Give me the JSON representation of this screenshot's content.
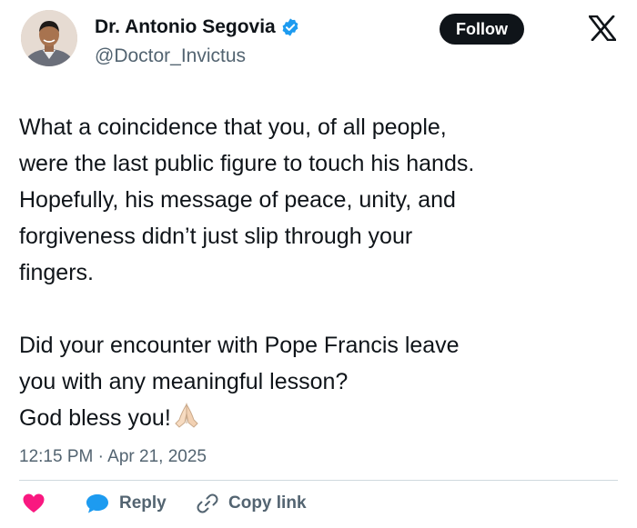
{
  "author": {
    "display_name": "Dr. Antonio Segovia",
    "handle": "@Doctor_Invictus",
    "verified": true,
    "avatar_icon": "profile-photo"
  },
  "header": {
    "follow_label": "Follow",
    "logo_icon": "x-logo-icon"
  },
  "tweet": {
    "text": "What a coincidence that you, of all people,\nwere the last public figure to touch his hands.\nHopefully, his message of peace, unity, and\nforgiveness didn’t just slip through your\nfingers.\n\nDid your encounter with Pope Francis leave\nyou with any meaningful lesson?\nGod bless you!",
    "emoji": "folded-hands-emoji",
    "timestamp": "12:15 PM · Apr 21, 2025"
  },
  "actions": {
    "like_icon": "heart-icon",
    "reply_label": "Reply",
    "reply_icon": "speech-bubble-icon",
    "copy_link_label": "Copy link",
    "copy_link_icon": "link-icon"
  },
  "colors": {
    "text": "#0f1419",
    "secondary": "#536471",
    "verified": "#1d9bf0",
    "like": "#f91880",
    "reply": "#1d9bf0",
    "button": "#0f1419",
    "divider": "#cfd9de"
  }
}
